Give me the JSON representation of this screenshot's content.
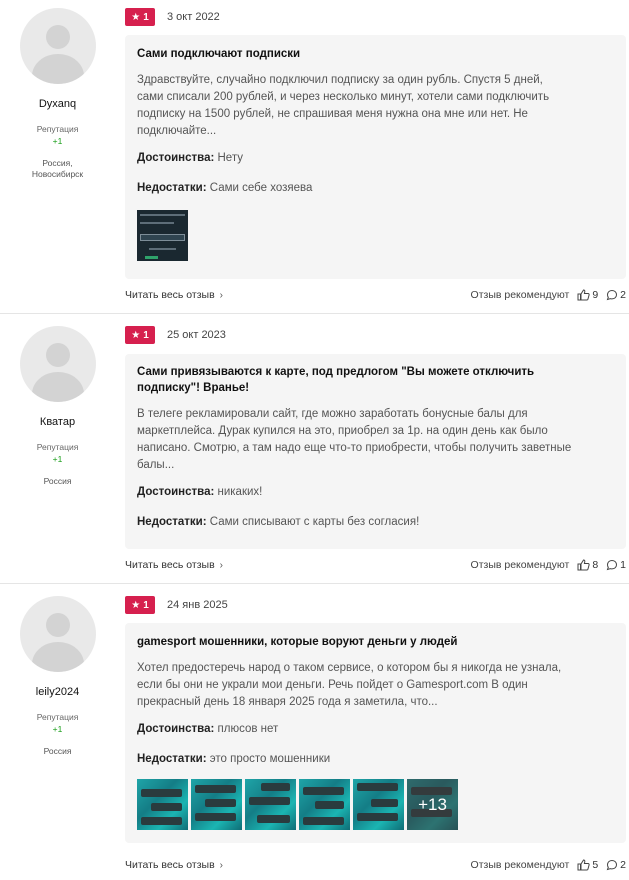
{
  "labels": {
    "reputation": "Репутация",
    "pros": "Достоинства:",
    "cons": "Недостатки:",
    "read_more": "Читать весь отзыв",
    "recommend": "Отзыв рекомендуют"
  },
  "colors": {
    "badge": "#d6204e",
    "rep_positive": "#1a9e1a",
    "card_bg": "#f5f5f5"
  },
  "reviews": [
    {
      "author": "Dyxanq",
      "reputation": "+1",
      "location_1": "Россия,",
      "location_2": "Новосибирск",
      "rating": "1",
      "date": "3 окт 2022",
      "title": "Сами подключают подписки",
      "text_1": "Здравствуйте, случайно подключил подписку за один рубль. Спустя 5 дней,",
      "text_2": "сами списали 200 рублей, и через несколько минут, хотели сами подключить",
      "text_3": "подписку на 1500 рублей, не спрашивая меня нужна она мне или нет. Не",
      "text_4": "подключайте...",
      "pros": "Нету",
      "cons": "Сами себе хозяева",
      "likes": "9",
      "comments": "2"
    },
    {
      "author": "Кватар",
      "reputation": "+1",
      "location_1": "Россия",
      "rating": "1",
      "date": "25 окт 2023",
      "title_1": "Сами привязываются к карте, под предлогом \"Вы можете отключить",
      "title_2": "подписку\"! Вранье!",
      "text_1": "В телеге рекламировали сайт, где можно заработать бонусные балы для",
      "text_2": "маркетплейса. Дурак купился на это, приобрел за 1р. на один день как было",
      "text_3": "написано. Смотрю, а там надо еще что-то приобрести, чтобы получить заветные",
      "text_4": "балы...",
      "pros": "никаких!",
      "cons": "Сами списывают с карты без согласия!",
      "likes": "8",
      "comments": "1"
    },
    {
      "author": "leily2024",
      "reputation": "+1",
      "location_1": "Россия",
      "rating": "1",
      "date": "24 янв 2025",
      "title": "gamesport мошенники, которые воруют деньги у людей",
      "text_1": "Хотел предостеречь народ о таком сервисе, о котором бы я никогда не узнала,",
      "text_2": "если бы они не украли мои деньги. Речь пойдет о Gamesport.com В один",
      "text_3": "прекрасный день 18 января 2025 года я заметила, что...",
      "pros": "плюсов нет",
      "cons": "это просто мошенники",
      "more_photos": "+13",
      "likes": "5",
      "comments": "2"
    }
  ]
}
